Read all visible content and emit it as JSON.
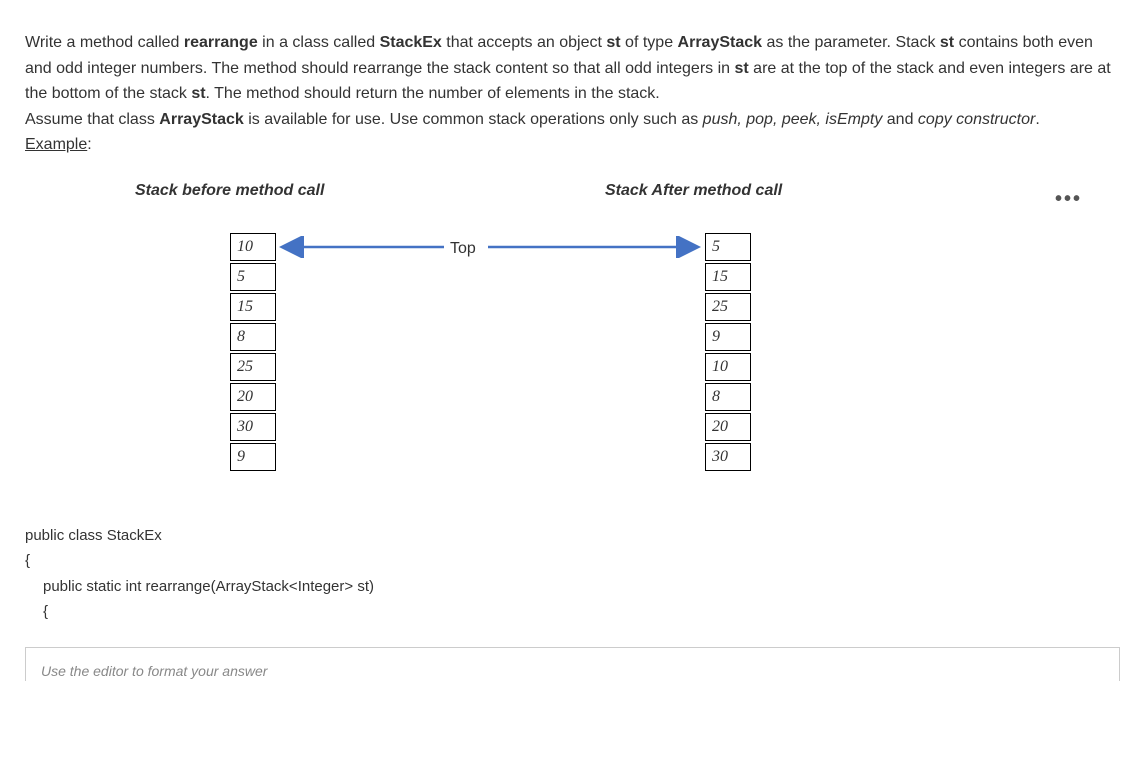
{
  "question": {
    "p1_pre": "Write a method called ",
    "p1_bold1": "rearrange",
    "p1_mid1": " in a class called ",
    "p1_bold2": "StackEx",
    "p1_mid2": " that accepts an object ",
    "p1_bold3": "st",
    "p1_mid3": " of type ",
    "p1_bold4": "ArrayStack",
    "p1_mid4": " as the parameter. Stack ",
    "p1_bold5": "st",
    "p1_mid5": " contains both even and odd integer numbers. The method should rearrange the stack content so that all odd integers in ",
    "p1_bold6": "st",
    "p1_mid6": " are at the top of the stack and even integers are at the bottom of the stack ",
    "p1_bold7": "st",
    "p1_mid7": ". The method should return the number of elements in the stack.",
    "p2_pre": "Assume that class ",
    "p2_bold1": "ArrayStack",
    "p2_mid1": " is available for use. Use common stack operations only such as ",
    "p2_italic1": "push, pop, peek, isEmpty",
    "p2_mid2": " and ",
    "p2_italic2": "copy constructor",
    "p2_end": ".",
    "example_label": "Example",
    "example_colon": ":"
  },
  "diagram": {
    "before_heading": "Stack before method call",
    "after_heading": "Stack After method call",
    "top_label": "Top",
    "ellipsis": "•••",
    "before_stack": [
      "10",
      "5",
      "15",
      "8",
      "25",
      "20",
      "30",
      "9"
    ],
    "after_stack": [
      "5",
      "15",
      "25",
      "9",
      "10",
      "8",
      "20",
      "30"
    ]
  },
  "code": {
    "line1": "public class StackEx",
    "line2": "{",
    "line3": "public static int rearrange(ArrayStack<Integer> st)",
    "line4": "{"
  },
  "editor": {
    "placeholder": "Use the editor to format your answer"
  }
}
